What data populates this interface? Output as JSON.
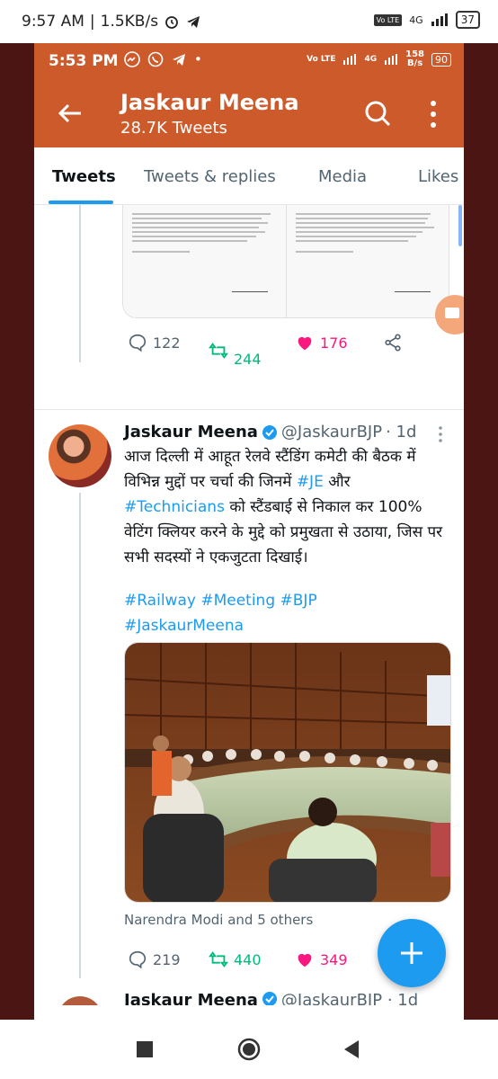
{
  "outer_status": {
    "time": "9:57 AM",
    "speed": "1.5KB/s",
    "network": "4G",
    "volte": "Vo LTE",
    "battery": "37"
  },
  "inner_status": {
    "time": "5:53 PM",
    "volte": "Vo LTE",
    "network": "4G",
    "speed_value": "158",
    "speed_unit": "B/s",
    "battery": "90"
  },
  "header": {
    "title": "Jaskaur Meena",
    "subtitle": "28.7K Tweets"
  },
  "tabs": [
    {
      "label": "Tweets",
      "active": true
    },
    {
      "label": "Tweets & replies",
      "active": false
    },
    {
      "label": "Media",
      "active": false
    },
    {
      "label": "Likes",
      "active": false
    }
  ],
  "tweet1": {
    "replies": "122",
    "retweets": "244",
    "likes": "176"
  },
  "tweet2": {
    "name": "Jaskaur Meena",
    "handle": "@JaskaurBJP",
    "time": "· 1d",
    "text_part1": "आज दिल्ली में आहूत रेलवे स्टैंडिंग कमेटी की बैठक में विभिन्न मुद्दों पर चर्चा की जिनमें ",
    "tag_je": "#JE",
    "text_part2": " और ",
    "tag_tech": "#Technicians",
    "text_part3": " को स्टैंडबाई से निकाल कर 100% वेटिंग क्लियर करने के मुद्दे को प्रमुखता से उठाया, जिस पर सभी सदस्यों ने एकजुटता दिखाई।",
    "hashtags_line1": "#Railway #Meeting #BJP",
    "hashtags_line2": "#JaskaurMeena",
    "tagged": "Narendra Modi and 5 others",
    "replies": "219",
    "retweets": "440",
    "likes": "349"
  },
  "tweet3": {
    "name": "Jaskaur Meena",
    "handle": "@JaskaurBJP · 1d"
  },
  "colors": {
    "header_bg": "#cd5a2b",
    "accent_blue": "#1d9bf0",
    "retweet_green": "#00ba7c",
    "like_pink": "#f91880",
    "frame": "#4a1512"
  }
}
